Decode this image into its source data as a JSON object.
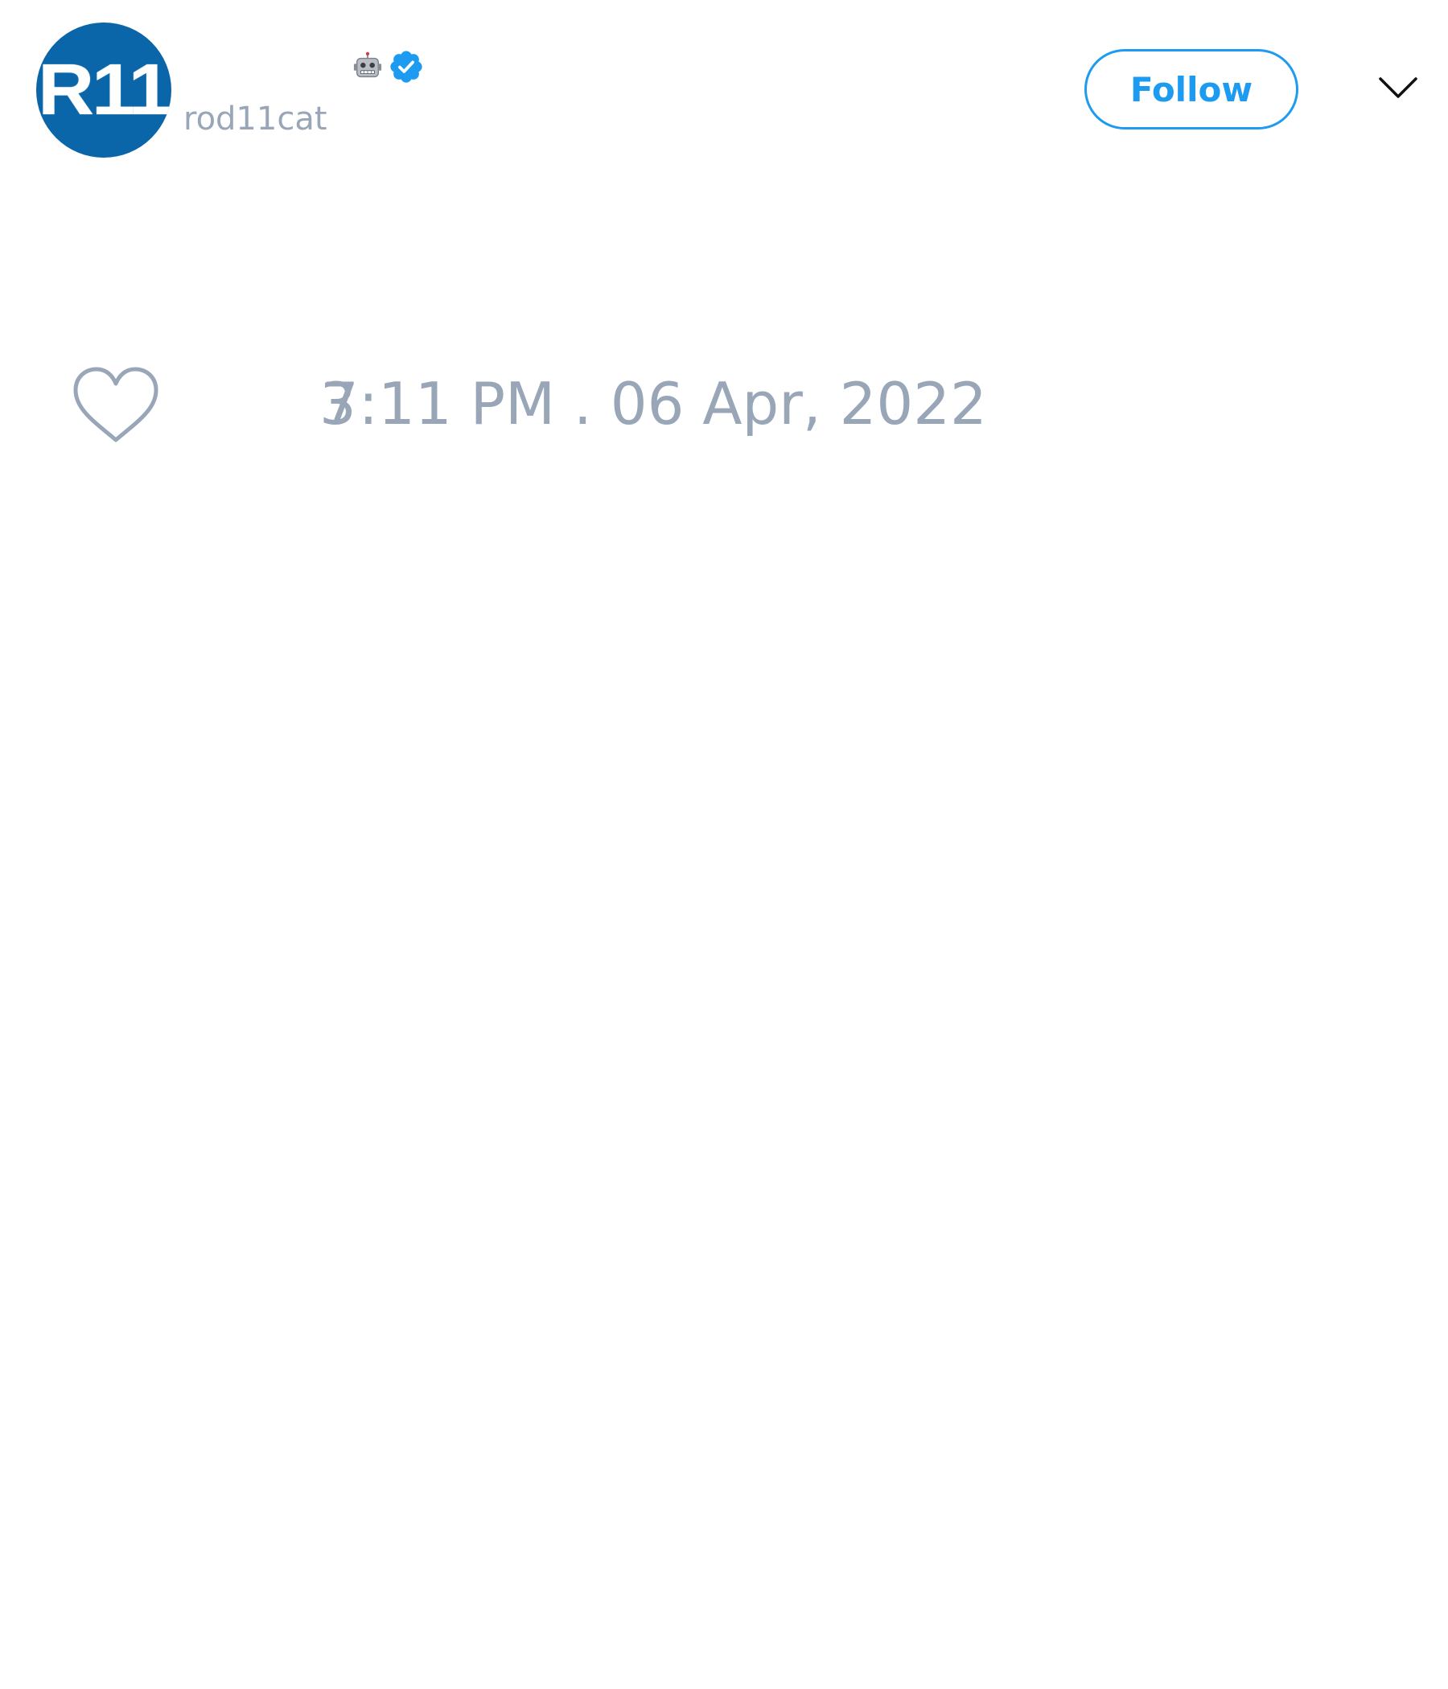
{
  "tweet": {
    "author": {
      "avatar_text": "R11",
      "username": "rod11cat",
      "badges": [
        "robot-icon",
        "verified-icon"
      ]
    },
    "follow_label": "Follow",
    "menu_icon": "chevron-down-icon",
    "likes": "3",
    "timestamp": "7:11 PM . 06 Apr, 2022"
  },
  "colors": {
    "accent": "#1d9bf0",
    "muted_text": "#98a6b8",
    "avatar_bg": "#0a66a8"
  }
}
